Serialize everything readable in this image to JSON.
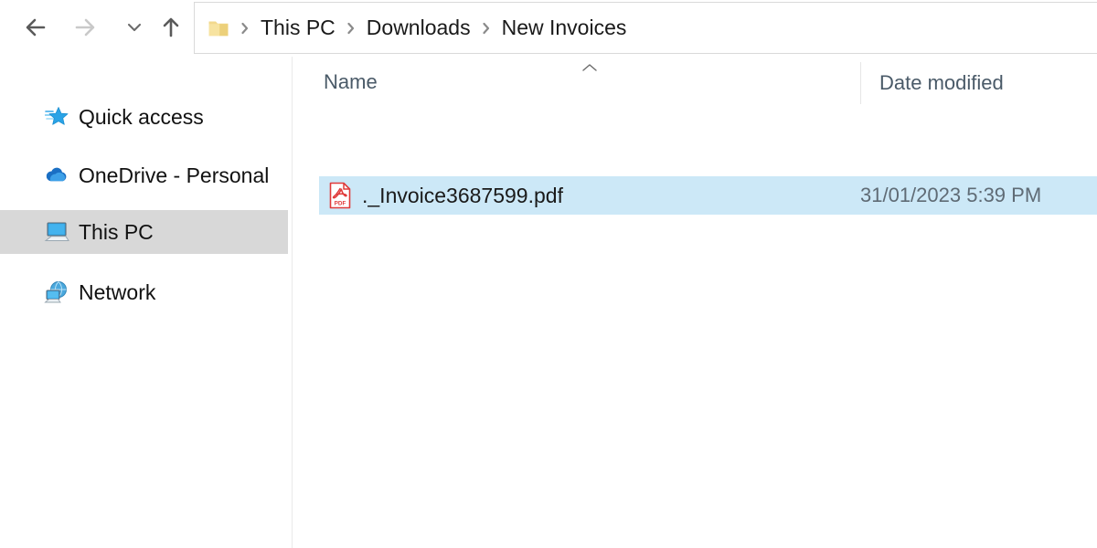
{
  "window": {
    "title": "New Invoices",
    "accent_selection_color": "#cce8f7",
    "sidebar_selection_color": "#d8d8d8"
  },
  "toolbar": {
    "back_label": "Back",
    "forward_label": "Forward",
    "recent_label": "Recent locations",
    "up_label": "Up to Downloads",
    "icons": {
      "back": "arrow-left-icon",
      "forward": "arrow-right-icon",
      "recent": "chevron-down-icon",
      "up": "arrow-up-icon"
    }
  },
  "address_bar": {
    "folder_icon": "folder-icon",
    "separator": "›",
    "crumbs": [
      {
        "label": "This PC"
      },
      {
        "label": "Downloads"
      },
      {
        "label": "New Invoices"
      }
    ]
  },
  "sidebar": {
    "items": [
      {
        "label": "Quick access",
        "icon": "star-icon",
        "selected": false
      },
      {
        "label": "OneDrive - Personal",
        "icon": "cloud-icon",
        "selected": false
      },
      {
        "label": "This PC",
        "icon": "monitor-icon",
        "selected": true
      },
      {
        "label": "Network",
        "icon": "globe-icon",
        "selected": false
      }
    ]
  },
  "file_list": {
    "columns": [
      {
        "label": "Name",
        "sorted": true,
        "sort_direction": "ascending"
      },
      {
        "label": "Date modified",
        "sorted": false,
        "sort_direction": ""
      }
    ],
    "sort_indicator_icon": "chevron-up-icon",
    "rows": [
      {
        "name": "._Invoice3687599.pdf",
        "date_modified": "31/01/2023 5:39 PM",
        "icon": "pdf-file-icon",
        "icon_label": "PDF",
        "selected": true
      }
    ]
  }
}
